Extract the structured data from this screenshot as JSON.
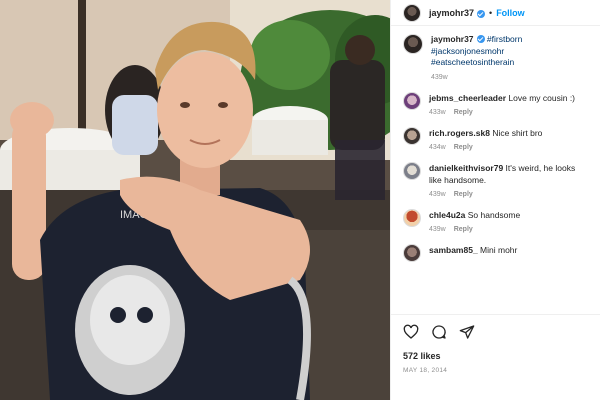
{
  "post": {
    "username": "jaymohr37",
    "follow_label": "Follow",
    "separator": "•",
    "shirt_text": "IMAGINE DRA"
  },
  "caption": {
    "username": "jaymohr37",
    "hashtags": [
      "#firstborn",
      "#jacksonjonesmohr",
      "#eatscheetosintherain"
    ],
    "time": "439w"
  },
  "comments": [
    {
      "username": "jebms_cheerleader",
      "text": "Love my cousin :)",
      "time": "433w",
      "reply_label": "Reply"
    },
    {
      "username": "rich.rogers.sk8",
      "text": "Nice shirt bro",
      "time": "434w",
      "reply_label": "Reply"
    },
    {
      "username": "danielkeithvisor79",
      "text": "It's weird, he looks like handsome.",
      "time": "439w",
      "reply_label": "Reply"
    },
    {
      "username": "chle4u2a",
      "text": "So handsome",
      "time": "439w",
      "reply_label": "Reply"
    },
    {
      "username": "sambam85_",
      "text": "Mini mohr"
    }
  ],
  "actions": {
    "icons": [
      "heart-icon",
      "comment-icon",
      "share-icon"
    ],
    "likes": "572 likes",
    "date": "MAY 18, 2014"
  },
  "colors": {
    "link": "#0095f6",
    "hashtag": "#00376b",
    "muted": "#8e8e8e",
    "verified": "#3897f0"
  }
}
